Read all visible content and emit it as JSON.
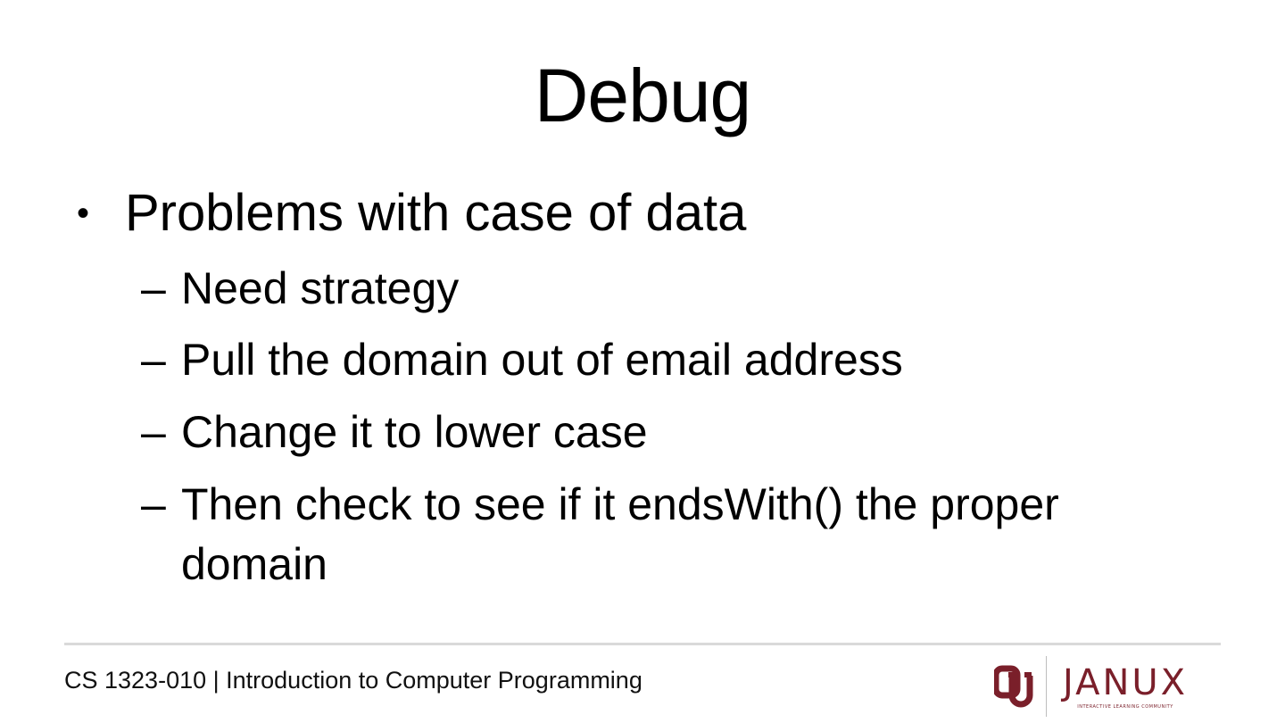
{
  "slide": {
    "title": "Debug",
    "bullet": "Problems with case of data",
    "bullet_marker": "•",
    "sub_marker": "–",
    "sub_points": [
      "Need strategy",
      "Pull the domain out of email address",
      "Change it to lower case",
      "Then check to see if it endsWith() the proper domain"
    ]
  },
  "footer": {
    "course": "CS 1323-010 | Introduction to Computer Programming"
  },
  "logo": {
    "wordmark": "JANUX",
    "tagline": "INTERACTIVE LEARNING COMMUNITY",
    "mark_icon": "ou-interlocking-logo",
    "brand_color": "#7a1f2a"
  }
}
